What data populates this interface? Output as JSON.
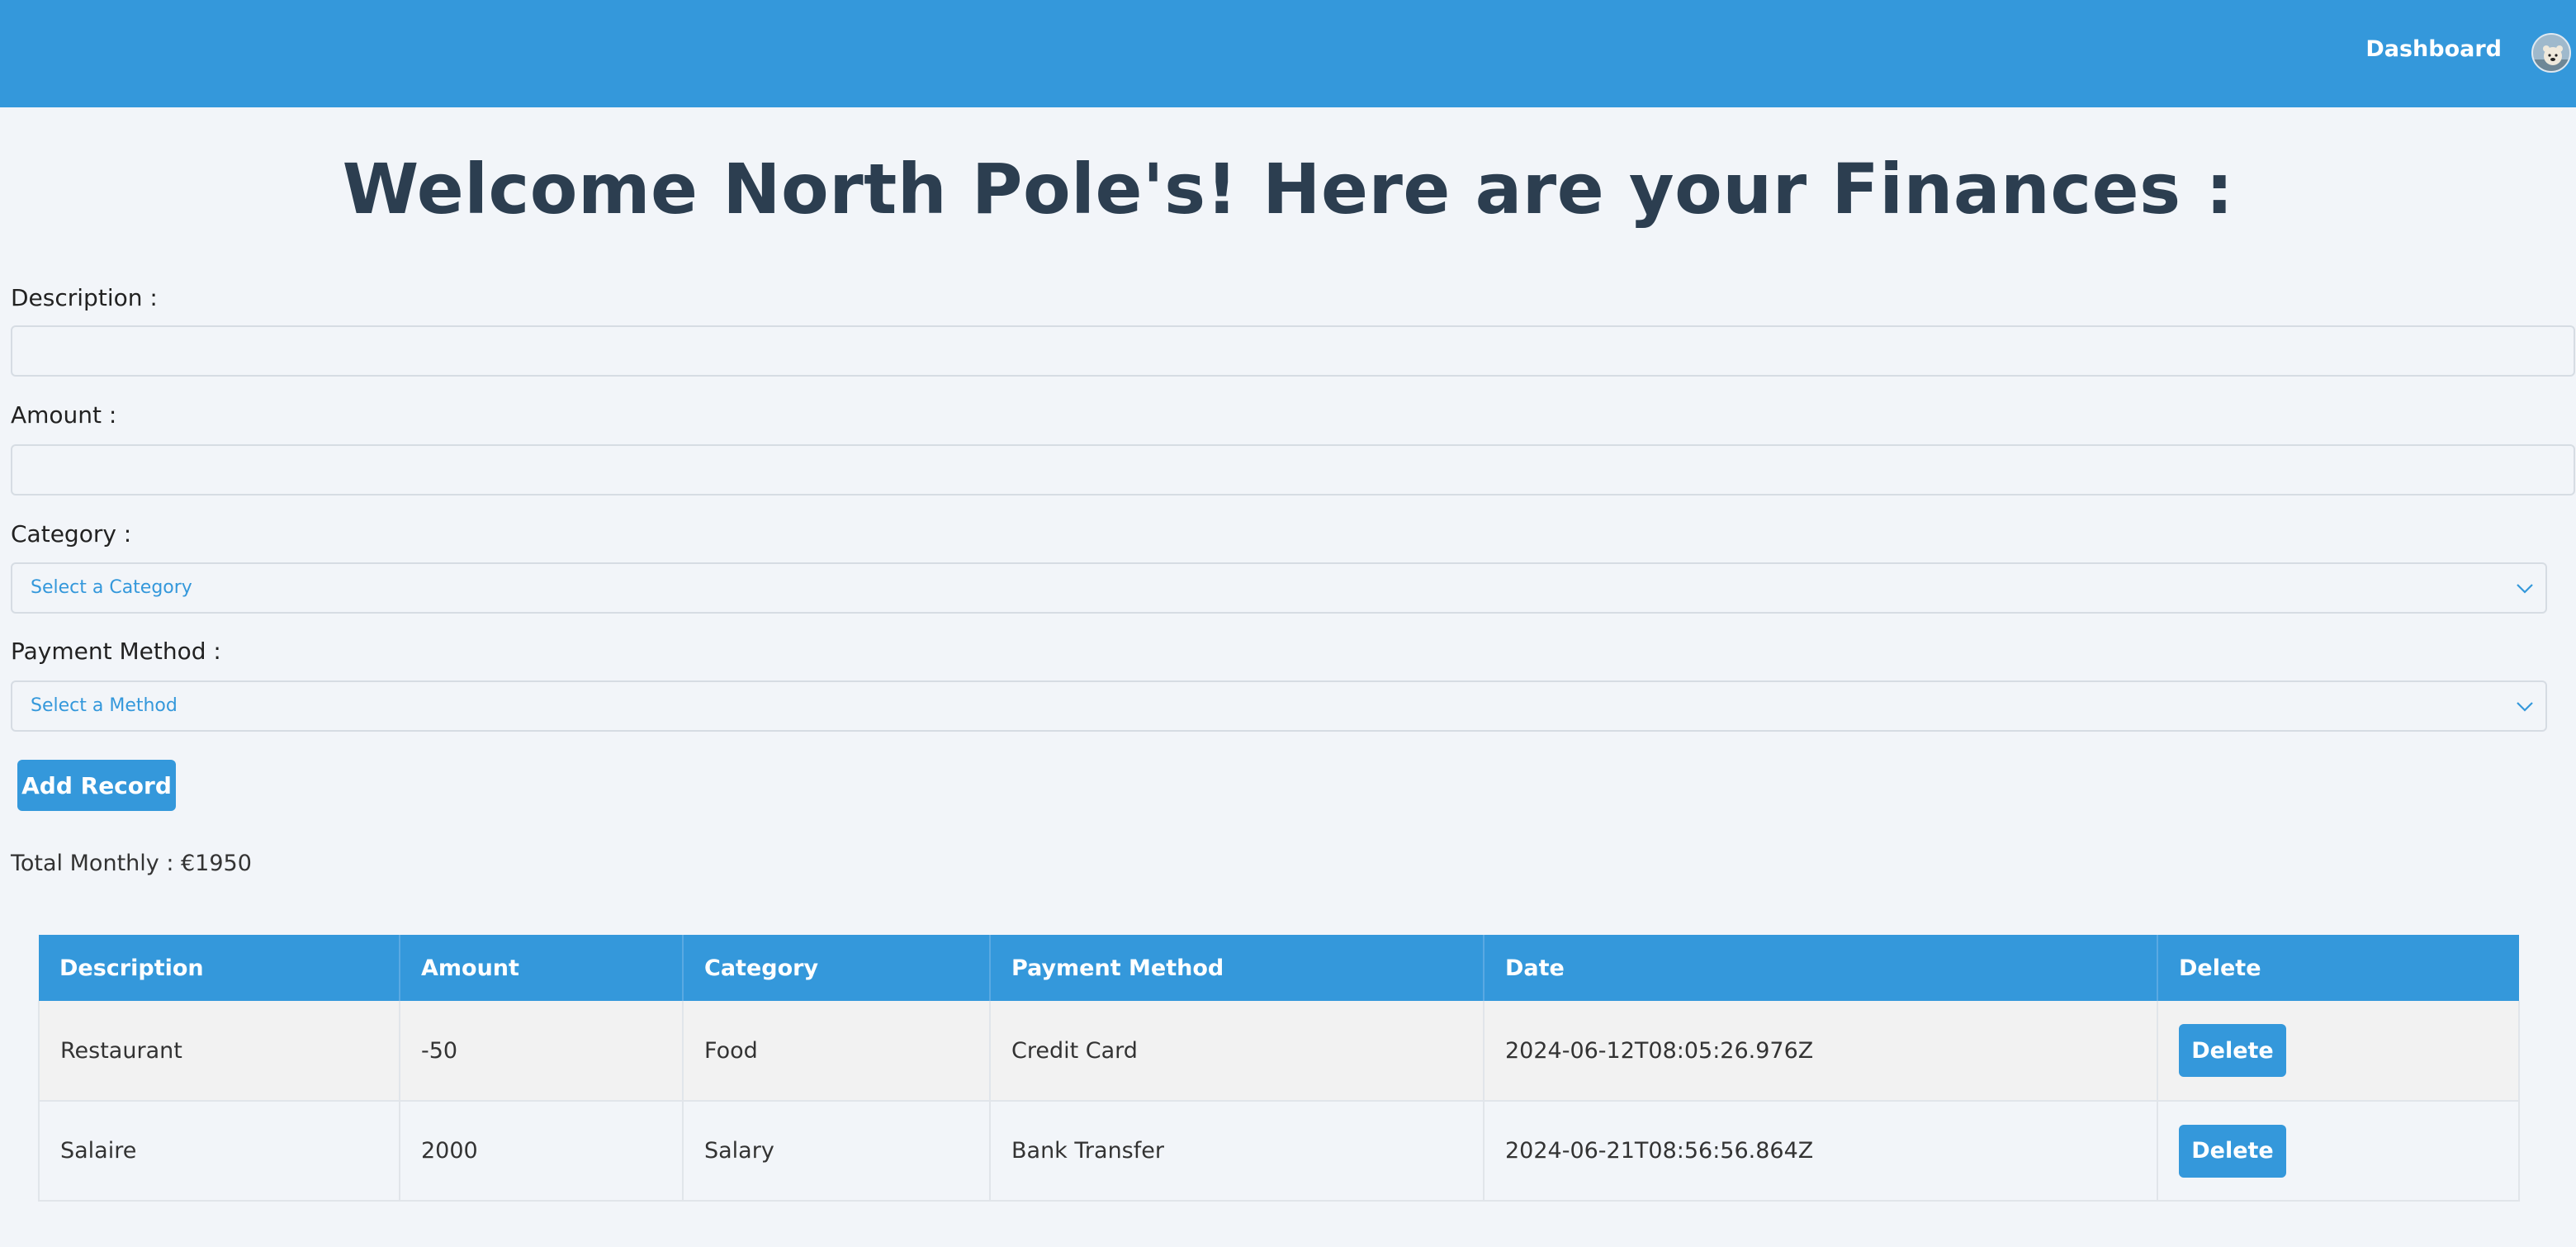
{
  "nav": {
    "dashboard_label": "Dashboard",
    "avatar_icon": "polar-bear-avatar"
  },
  "page": {
    "title": "Welcome North Pole's! Here are your Finances :"
  },
  "form": {
    "description_label": "Description :",
    "description_value": "",
    "amount_label": "Amount :",
    "amount_value": "",
    "category_label": "Category :",
    "category_selected": "Select a Category",
    "payment_label": "Payment Method :",
    "payment_selected": "Select a Method",
    "add_button": "Add Record"
  },
  "summary": {
    "total_text": "Total Monthly : €1950"
  },
  "table": {
    "headers": [
      "Description",
      "Amount",
      "Category",
      "Payment Method",
      "Date",
      "Delete"
    ],
    "rows": [
      {
        "description": "Restaurant",
        "amount": "-50",
        "category": "Food",
        "payment": "Credit Card",
        "date": "2024-06-12T08:05:26.976Z",
        "delete": "Delete"
      },
      {
        "description": "Salaire",
        "amount": "2000",
        "category": "Salary",
        "payment": "Bank Transfer",
        "date": "2024-06-21T08:56:56.864Z",
        "delete": "Delete"
      }
    ]
  },
  "colors": {
    "accent": "#3498db",
    "title": "#2c3e50",
    "background": "#f2f5f9"
  }
}
